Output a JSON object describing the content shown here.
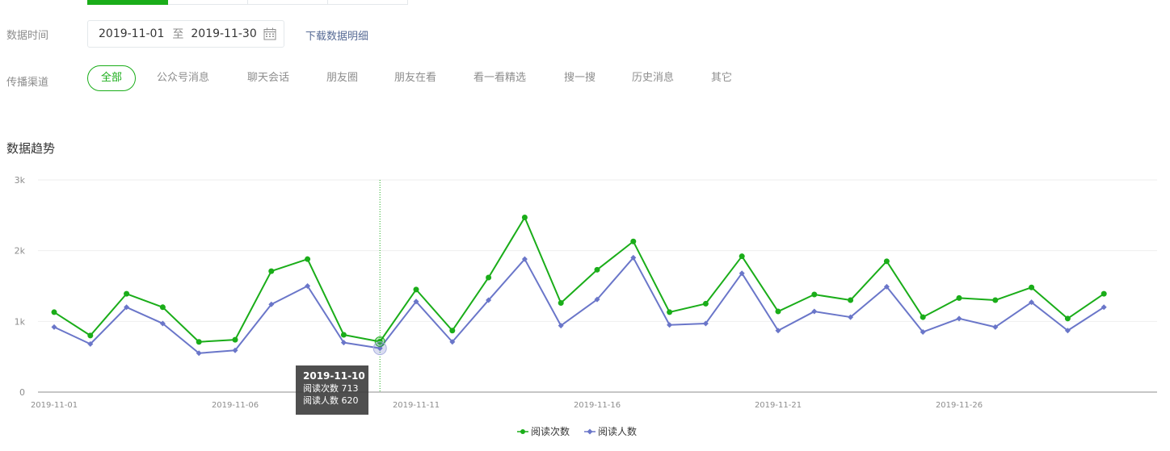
{
  "filters": {
    "date_label": "数据时间",
    "date_start": "2019-11-01",
    "date_sep": "至",
    "date_end": "2019-11-30",
    "download_label": "下载数据明细",
    "channel_label": "传播渠道",
    "channels": [
      "全部",
      "公众号消息",
      "聊天会话",
      "朋友圈",
      "朋友在看",
      "看一看精选",
      "搜一搜",
      "历史消息",
      "其它"
    ]
  },
  "section_title": "数据趋势",
  "tooltip": {
    "date": "2019-11-10",
    "line1": "阅读次数 713",
    "line2": "阅读人数 620"
  },
  "colors": {
    "accent": "#1aad19",
    "series2": "#6a76c9",
    "link": "#576b95"
  },
  "chart_data": {
    "type": "line",
    "x": [
      "2019-11-01",
      "2019-11-02",
      "2019-11-03",
      "2019-11-04",
      "2019-11-05",
      "2019-11-06",
      "2019-11-07",
      "2019-11-08",
      "2019-11-09",
      "2019-11-10",
      "2019-11-11",
      "2019-11-12",
      "2019-11-13",
      "2019-11-14",
      "2019-11-15",
      "2019-11-16",
      "2019-11-17",
      "2019-11-18",
      "2019-11-19",
      "2019-11-20",
      "2019-11-21",
      "2019-11-22",
      "2019-11-23",
      "2019-11-24",
      "2019-11-25",
      "2019-11-26",
      "2019-11-27",
      "2019-11-28",
      "2019-11-29",
      "2019-11-30"
    ],
    "x_tick_labels": [
      "2019-11-01",
      "2019-11-06",
      "2019-11-11",
      "2019-11-16",
      "2019-11-21",
      "2019-11-26"
    ],
    "y_ticks": [
      0,
      1000,
      2000,
      3000
    ],
    "y_tick_labels": [
      "0",
      "1k",
      "2k",
      "3k"
    ],
    "ylim": [
      0,
      3000
    ],
    "series": [
      {
        "name": "阅读次数",
        "color": "#1aad19",
        "values": [
          1130,
          800,
          1390,
          1200,
          710,
          740,
          1710,
          1880,
          810,
          713,
          1450,
          870,
          1620,
          2470,
          1260,
          1730,
          2130,
          1130,
          1250,
          1920,
          1140,
          1380,
          1300,
          1850,
          1060,
          1330,
          1300,
          1480,
          1040,
          1390
        ]
      },
      {
        "name": "阅读人数",
        "color": "#6a76c9",
        "values": [
          920,
          680,
          1200,
          970,
          550,
          590,
          1240,
          1500,
          700,
          620,
          1280,
          710,
          1300,
          1880,
          940,
          1310,
          1900,
          950,
          970,
          1680,
          870,
          1140,
          1060,
          1490,
          850,
          1040,
          920,
          1270,
          870,
          1200
        ]
      }
    ],
    "highlight_index": 9,
    "grid": true,
    "legend_position": "bottom-center"
  }
}
